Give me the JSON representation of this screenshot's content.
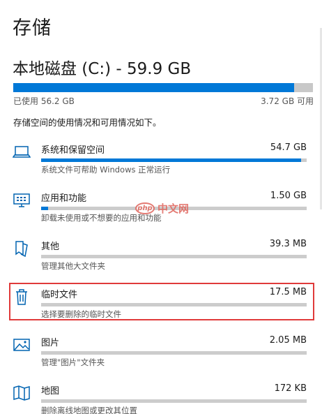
{
  "page": {
    "title": "存储"
  },
  "disk": {
    "title": "本地磁盘 (C:) - 59.9 GB",
    "used_fraction": 0.938,
    "used_label": "已使用 56.2 GB",
    "free_label": "3.72 GB 可用",
    "description": "存储空间的使用情况和可用情况如下。"
  },
  "items": [
    {
      "icon": "laptop-icon",
      "name": "系统和保留空间",
      "size": "54.7 GB",
      "fraction": 0.978,
      "subtitle": "系统文件可帮助 Windows 正常运行"
    },
    {
      "icon": "apps-monitor-icon",
      "name": "应用和功能",
      "size": "1.50 GB",
      "fraction": 0.027,
      "subtitle": "卸载未使用或不想要的应用和功能"
    },
    {
      "icon": "document-other-icon",
      "name": "其他",
      "size": "39.3 MB",
      "fraction": 0.0,
      "subtitle": "管理其他大文件夹"
    },
    {
      "icon": "trash-icon",
      "name": "临时文件",
      "size": "17.5 MB",
      "fraction": 0.0,
      "subtitle": "选择要删除的临时文件"
    },
    {
      "icon": "picture-icon",
      "name": "图片",
      "size": "2.05 MB",
      "fraction": 0.0,
      "subtitle": "管理\"图片\"文件夹"
    },
    {
      "icon": "map-icon",
      "name": "地图",
      "size": "172 KB",
      "fraction": 0.0,
      "subtitle": "删除离线地图或更改其位置"
    }
  ],
  "watermark": {
    "logo": "php",
    "text": "中文网"
  },
  "colors": {
    "accent": "#0078d7",
    "bar_bg": "#cccccc",
    "highlight": "#e03a3a"
  }
}
